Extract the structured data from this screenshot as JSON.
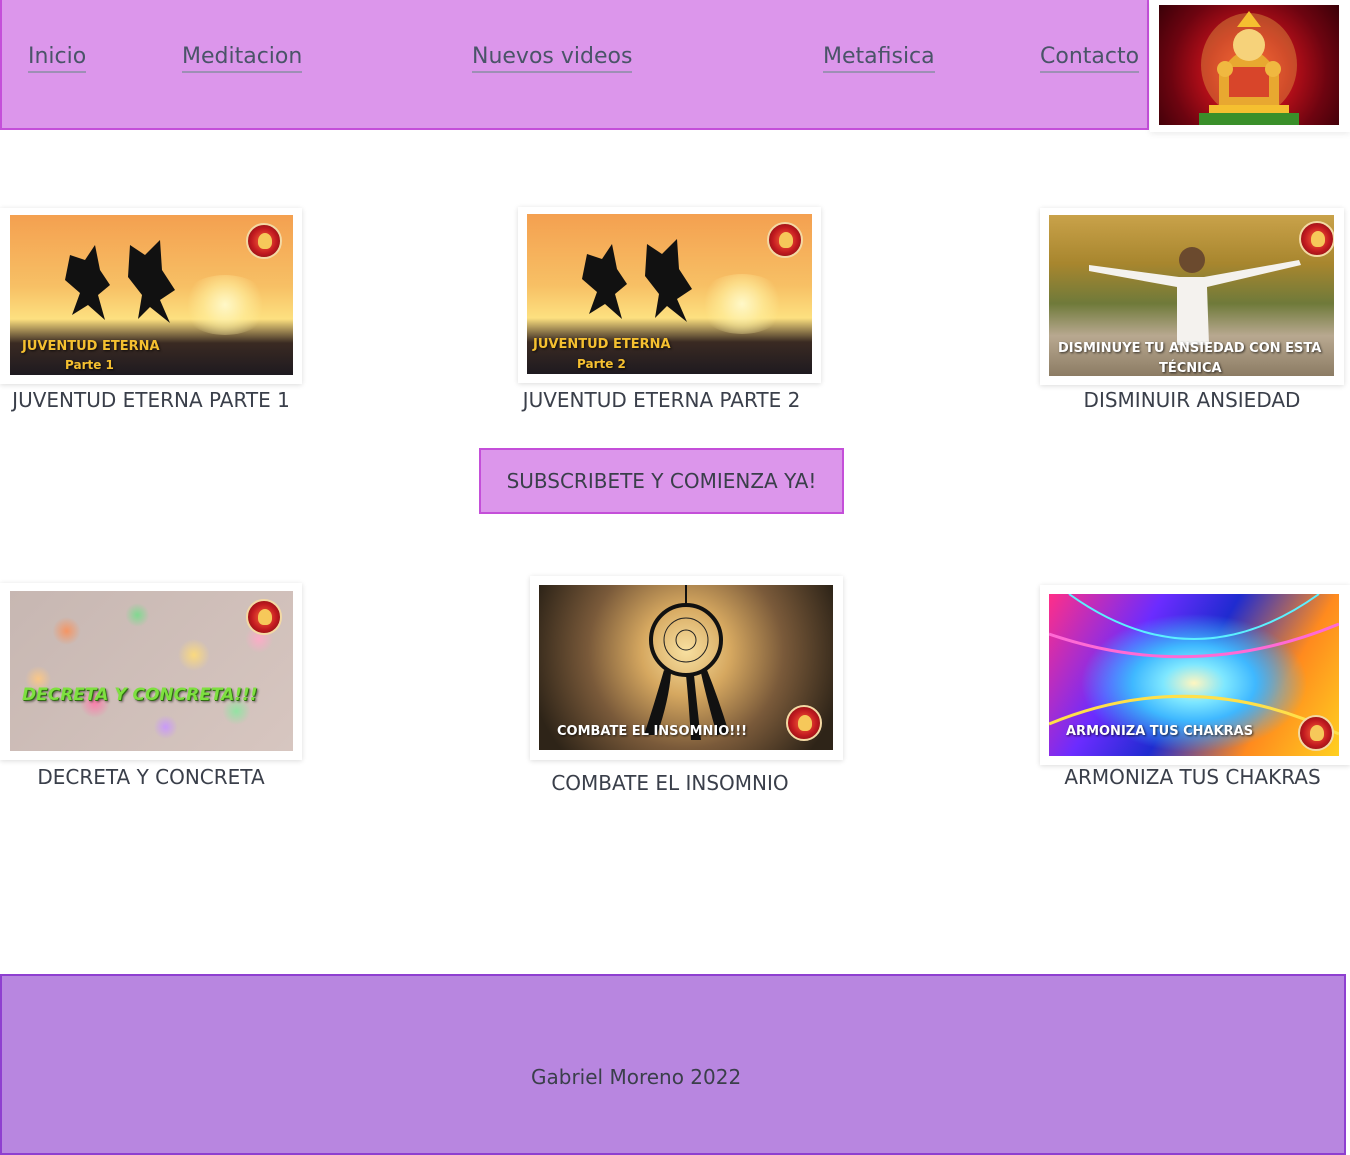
{
  "nav": {
    "links": [
      "Inicio",
      "Meditacion",
      "Nuevos videos",
      "Metafisica",
      "Contacto"
    ]
  },
  "logo": {
    "icon": "ganesha-logo"
  },
  "videos": [
    {
      "caption": "JUVENTUD ETERNA PARTE 1",
      "overlay_line1": "JUVENTUD ETERNA",
      "overlay_line2": "Parte 1"
    },
    {
      "caption": "JUVENTUD ETERNA PARTE 2",
      "overlay_line1": "JUVENTUD ETERNA",
      "overlay_line2": "Parte 2"
    },
    {
      "caption": "DISMINUIR ANSIEDAD",
      "overlay_line1": "DISMINUYE TU ANSIEDAD CON ESTA",
      "overlay_line2": "TÉCNICA"
    },
    {
      "caption": "DECRETA Y CONCRETA",
      "overlay_line1": "DECRETA Y CONCRETA!!!"
    },
    {
      "caption": "COMBATE EL INSOMNIO",
      "overlay_line1": "COMBATE EL INSOMNIO!!!"
    },
    {
      "caption": "ARMONIZA TUS CHAKRAS",
      "overlay_line1": "ARMONIZA TUS CHAKRAS"
    }
  ],
  "subscribe": {
    "label": "SUBSCRIBETE Y COMIENZA YA!"
  },
  "footer": {
    "text": "Gabriel Moreno 2022"
  },
  "colors": {
    "nav_bg": "#dc96eb",
    "nav_border": "#c44fd9",
    "footer_bg": "#b886e0",
    "footer_border": "#8e3fd0"
  }
}
